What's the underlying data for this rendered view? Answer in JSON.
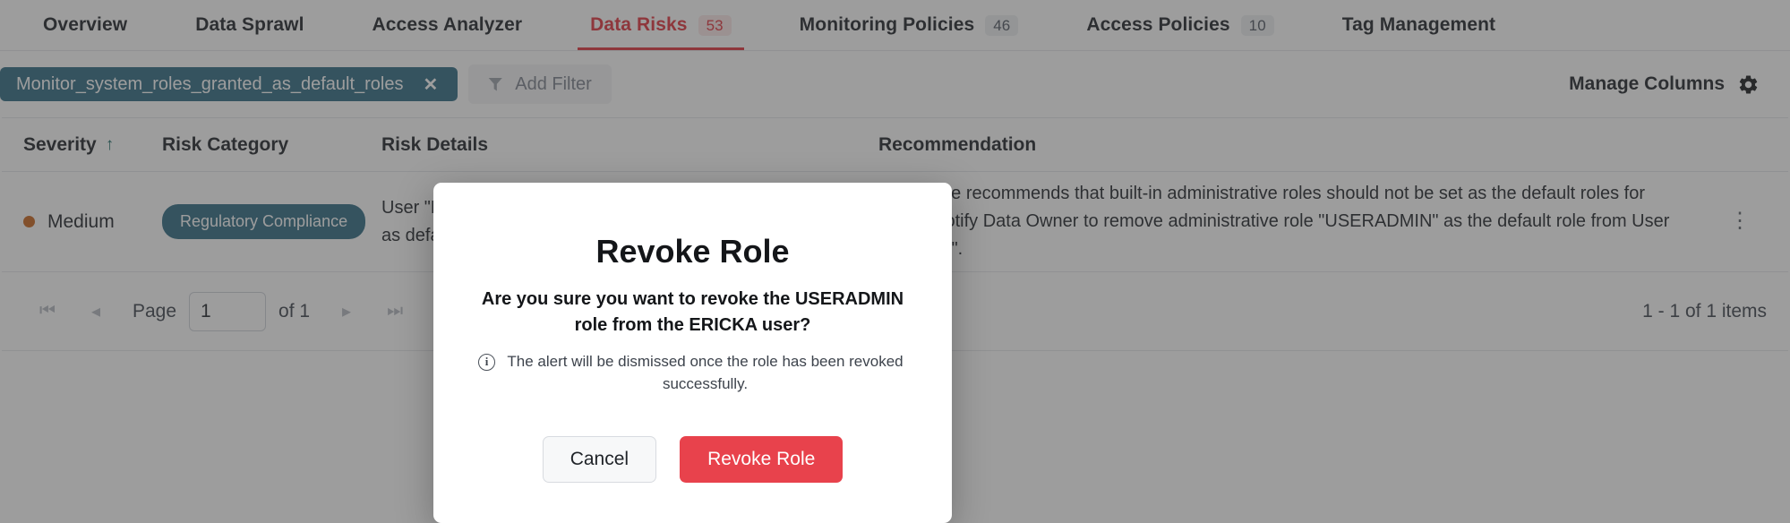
{
  "tabs": [
    {
      "label": "Overview",
      "count": null,
      "active": false
    },
    {
      "label": "Data Sprawl",
      "count": null,
      "active": false
    },
    {
      "label": "Access Analyzer",
      "count": null,
      "active": false
    },
    {
      "label": "Data Risks",
      "count": "53",
      "active": true
    },
    {
      "label": "Monitoring Policies",
      "count": "46",
      "active": false
    },
    {
      "label": "Access Policies",
      "count": "10",
      "active": false
    },
    {
      "label": "Tag Management",
      "count": null,
      "active": false
    }
  ],
  "filters": {
    "chip_label": "Monitor_system_roles_granted_as_default_roles",
    "chip_close": "✕",
    "add_filter_label": "Add Filter",
    "manage_columns_label": "Manage Columns"
  },
  "table": {
    "columns": [
      {
        "label": "Severity",
        "sort": "↑"
      },
      {
        "label": "Risk Category",
        "sort": ""
      },
      {
        "label": "Risk Details",
        "sort": ""
      },
      {
        "label": "Recommendation",
        "sort": ""
      }
    ],
    "rows": [
      {
        "severity": "Medium",
        "severity_color": "#c8641c",
        "category": "Regulatory Compliance",
        "details": "User \"ERICKA\" has administrative role \"USERADMIN\" set as default role.",
        "recommendation": "Snowflake recommends that built-in administrative roles should not be set as the default roles for users. Notify Data Owner to remove administrative role \"USERADMIN\" as the default role from User \"ERICKA\".",
        "menu": "⋮"
      }
    ]
  },
  "pagination": {
    "first": "⏮",
    "prev": "◂",
    "page_label": "Page",
    "page_value": "1",
    "of_label": "of 1",
    "next": "▸",
    "last": "⏭",
    "page_size": "20",
    "items_label": "1 - 1 of 1 items"
  },
  "modal": {
    "title": "Revoke Role",
    "question": "Are you sure you want to revoke the USERADMIN role from the ERICKA user?",
    "note": "The alert will be dismissed once the role has been revoked successfully.",
    "cancel_label": "Cancel",
    "confirm_label": "Revoke Role"
  },
  "colors": {
    "accent_red": "#e0333c",
    "danger_button": "#e8424c",
    "chip_teal": "#2e6a83",
    "severity_medium": "#c8641c",
    "sort_arrow": "#1b6b66"
  }
}
